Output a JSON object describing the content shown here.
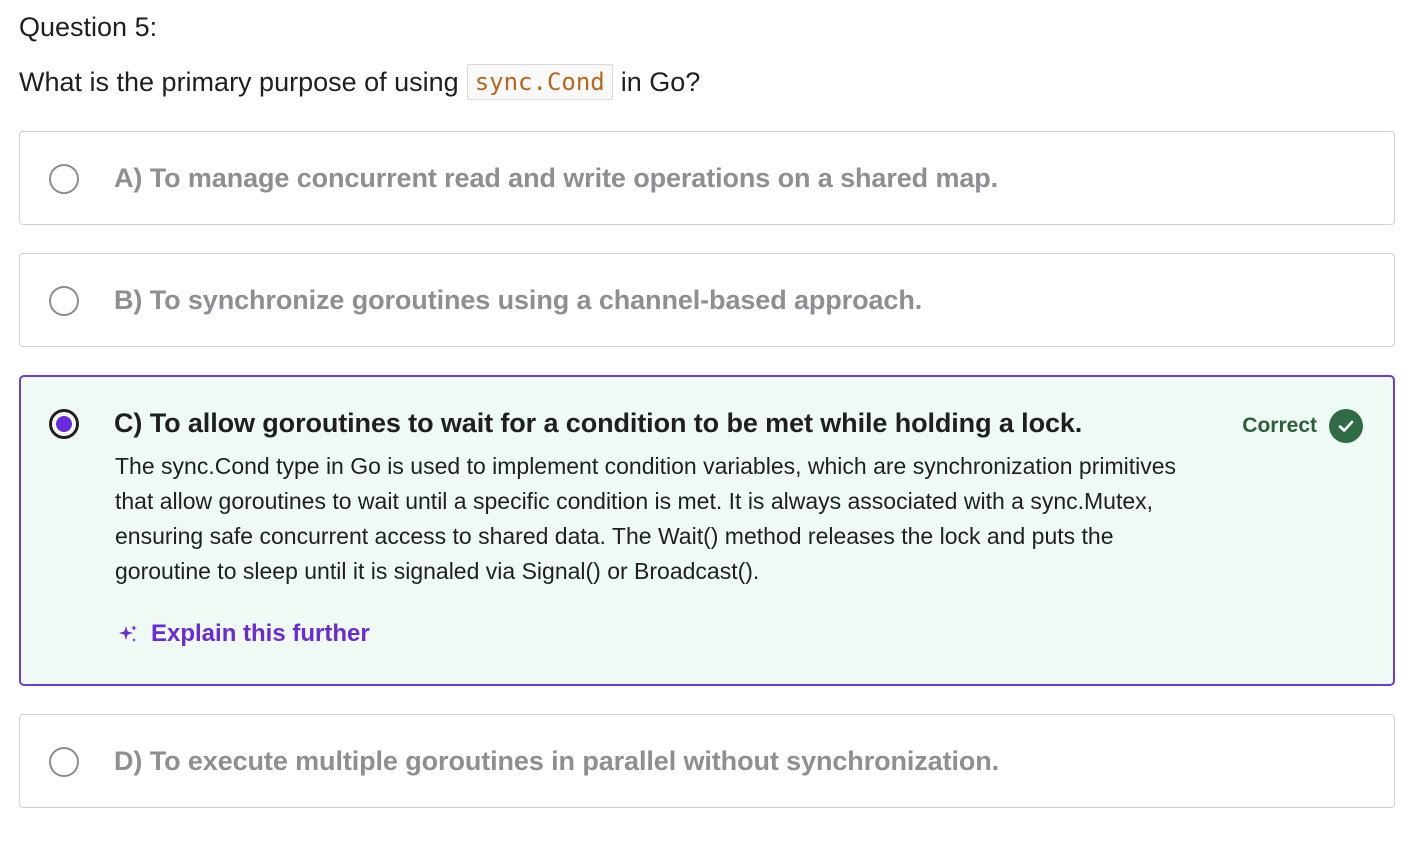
{
  "question": {
    "number_label": "Question 5:",
    "prompt_before": "What is the primary purpose of using",
    "prompt_code": "sync.Cond",
    "prompt_after": "in Go?"
  },
  "options": [
    {
      "label": "A) To manage concurrent read and write operations on a shared map.",
      "selected": false
    },
    {
      "label": "B) To synchronize goroutines using a channel-based approach.",
      "selected": false
    },
    {
      "label": "C) To allow goroutines to wait for a condition to be met while holding a lock.",
      "selected": true,
      "status": "Correct",
      "explanation": "The sync.Cond type in Go is used to implement condition variables, which are synchronization primitives that allow goroutines to wait until a specific condition is met. It is always associated with a sync.Mutex, ensuring safe concurrent access to shared data. The Wait() method releases the lock and puts the goroutine to sleep until it is signaled via Signal() or Broadcast().",
      "explain_link": "Explain this further"
    },
    {
      "label": "D) To execute multiple goroutines in parallel without synchronization.",
      "selected": false
    }
  ],
  "icons": {
    "correct": "check-circle-icon",
    "explain": "sparkle-icon",
    "radio": "radio-circle-icon"
  },
  "colors": {
    "accent_purple": "#6a2be0",
    "correct_green": "#2f6b45",
    "correct_bg": "#eefaf3",
    "code_text": "#b5681b"
  }
}
